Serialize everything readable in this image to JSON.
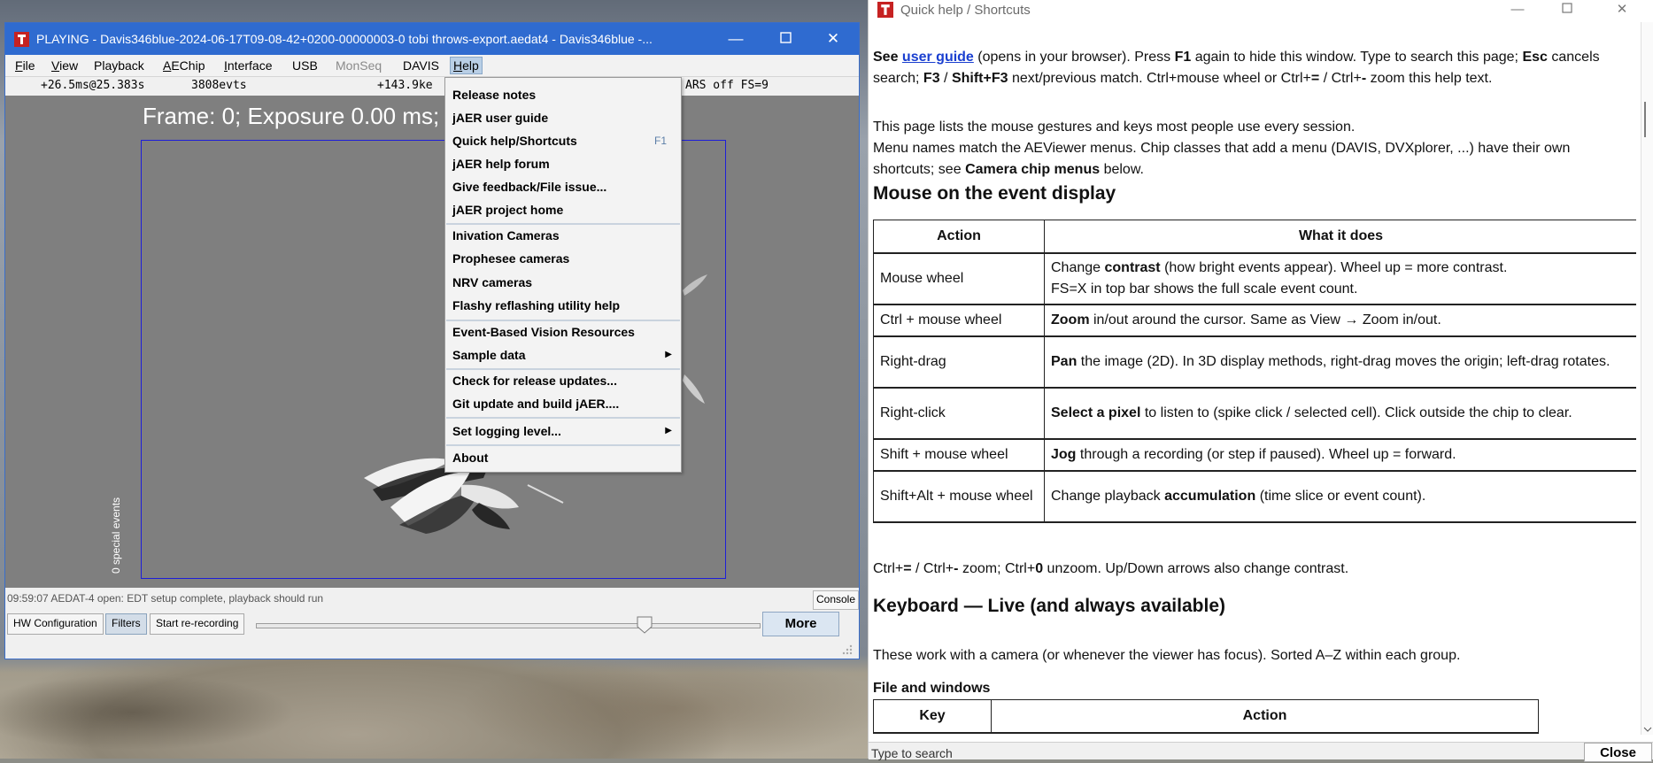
{
  "main_window": {
    "title": "PLAYING - Davis346blue-2024-06-17T09-08-42+0200-00000003-0 tobi throws-export.aedat4 - Davis346blue -...",
    "menus": [
      {
        "label": "File",
        "mnemonic": "F",
        "rest": "ile",
        "disabled": false
      },
      {
        "label": "View",
        "mnemonic": "V",
        "rest": "iew",
        "disabled": false
      },
      {
        "label": "Playback",
        "mnemonic": "",
        "rest": "Playback",
        "disabled": false
      },
      {
        "label": "AEChip",
        "mnemonic": "A",
        "rest": "EChip",
        "disabled": false
      },
      {
        "label": "Interface",
        "mnemonic": "I",
        "rest": "nterface",
        "disabled": false
      },
      {
        "label": "USB",
        "mnemonic": "",
        "rest": "USB",
        "disabled": false
      },
      {
        "label": "MonSeq",
        "mnemonic": "",
        "rest": "MonSeq",
        "disabled": true
      },
      {
        "label": "DAVIS",
        "mnemonic": "",
        "rest": "DAVIS",
        "disabled": false
      },
      {
        "label": "Help",
        "mnemonic": "H",
        "rest": "elp",
        "disabled": false
      }
    ],
    "status_top": {
      "time": "+26.5ms@25.383s",
      "events": "3808evts",
      "rate": "+143.9ke",
      "tail": "ARS off FS=9"
    },
    "display": {
      "frame_label": "Frame: 0; Exposure 0.00 ms; 0 Hz",
      "special_events": "0 special events"
    },
    "log_line": "09:59:07 AEDAT-4 open: EDT setup complete, playback should run",
    "console_button": "Console",
    "bottom_buttons": {
      "hw_config": "HW Configuration",
      "filters": "Filters",
      "rerecord": "Start re-recording",
      "more": "More"
    },
    "slider_position": 0.77
  },
  "help_menu": {
    "items": [
      {
        "label": "Release notes"
      },
      {
        "label": "jAER user guide"
      },
      {
        "label": "Quick help/Shortcuts",
        "accel": "F1"
      },
      {
        "label": "jAER help forum"
      },
      {
        "label": "Give feedback/File issue..."
      },
      {
        "label": "jAER project home"
      },
      {
        "label": "Inivation Cameras"
      },
      {
        "label": "Prophesee cameras"
      },
      {
        "label": "NRV cameras"
      },
      {
        "label": "Flashy reflashing utility help"
      },
      {
        "label": "Event-Based Vision Resources"
      },
      {
        "label": "Sample data",
        "submenu": true
      },
      {
        "label": "Check for release updates..."
      },
      {
        "label": "Git update and build jAER...."
      },
      {
        "label": "Set logging level...",
        "submenu": true
      },
      {
        "label": "About"
      }
    ]
  },
  "help_window": {
    "title": "Quick help / Shortcuts",
    "intro": {
      "see": "See",
      "user_guide_link": "user guide",
      "p1a": "(opens in your browser). Press",
      "f1": "F1",
      "p1b": "again to hide this window. Type to search this page;",
      "esc": "Esc",
      "p1c": "cancels search;",
      "f3": "F3",
      "slash": "/",
      "shiftf3": "Shift+F3",
      "p1d": "next/previous match. Ctrl+mouse wheel or Ctrl+",
      "eq": "=",
      "p1e": "/ Ctrl+",
      "minus": "-",
      "p1f": "zoom this help text.",
      "p2": "This page lists the mouse gestures and keys most people use every session.",
      "p3a": "Menu names match the AEViewer menus. Chip classes that add a menu (DAVIS, DVXplorer, ...) have their own shortcuts; see",
      "p3b": "Camera chip menus",
      "p3c": "below."
    },
    "mouse_section": {
      "heading": "Mouse on the event display",
      "col_action": "Action",
      "col_what": "What it does",
      "rows": [
        {
          "action": "Mouse wheel",
          "pre": "Change",
          "bold": "contrast",
          "post": "(how bright events appear). Wheel up = more contrast.",
          "line2": "FS=X in top bar shows the full scale event count."
        },
        {
          "action": "Ctrl + mouse wheel",
          "pre": "",
          "bold": "Zoom",
          "post": "in/out around the cursor. Same as View → Zoom in/out.",
          "line2": ""
        },
        {
          "action": "Right-drag",
          "pre": "",
          "bold": "Pan",
          "post": "the image (2D). In 3D display methods, right-drag moves the origin; left-drag rotates.",
          "line2": ""
        },
        {
          "action": "Right-click",
          "pre": "",
          "bold": "Select a pixel",
          "post": "to listen to (spike click / selected cell). Click outside the chip to clear.",
          "line2": ""
        },
        {
          "action": "Shift + mouse wheel",
          "pre": "",
          "bold": "Jog",
          "post": "through a recording (or step if paused). Wheel up = forward.",
          "line2": ""
        },
        {
          "action": "Shift+Alt + mouse wheel",
          "pre": "Change playback",
          "bold": "accumulation",
          "post": "(time slice or event count).",
          "line2": ""
        }
      ],
      "footer_a": "Ctrl+",
      "footer_eq": "=",
      "footer_b": "/ Ctrl+",
      "footer_minus": "-",
      "footer_c": "zoom; Ctrl+",
      "footer_zero": "0",
      "footer_d": "unzoom. Up/Down arrows also change contrast."
    },
    "keyboard_section": {
      "heading": "Keyboard — Live (and always available)",
      "intro": "These work with a camera (or whenever the viewer has focus). Sorted A–Z within each group.",
      "sub_heading": "File and windows",
      "col_key": "Key",
      "col_action": "Action"
    },
    "search_label": "Type to search",
    "close_button": "Close"
  },
  "colors": {
    "title_blue": "#2f6bd0",
    "link_blue": "#1a3fd0",
    "chip_box_border": "#1e1ed8",
    "display_gray": "#7f7f7f"
  }
}
